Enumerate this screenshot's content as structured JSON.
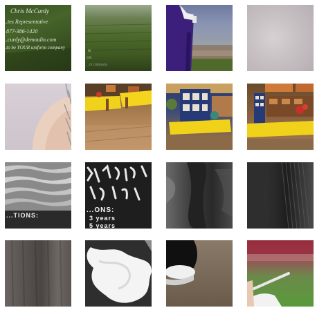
{
  "grid": {
    "tiles": [
      {
        "id": "business-card-on-grass",
        "lines": [
          "Chris McCurdy",
          "...tes Representative",
          "877-386-1420",
          "...curdy@demoulin.com",
          "...to be YOUR uniform company"
        ]
      },
      {
        "id": "grass-field"
      },
      {
        "id": "marching-band-purple-uniform"
      },
      {
        "id": "grey-fabric-close"
      },
      {
        "id": "arm-with-pompom"
      },
      {
        "id": "booth-yellow-tables"
      },
      {
        "id": "booth-framed-photos"
      },
      {
        "id": "booth-shelves-flowers"
      },
      {
        "id": "grey-banner-stripes",
        "lines": [
          "...TIONS:"
        ]
      },
      {
        "id": "black-banner-white-script",
        "lines": [
          "...ONS:",
          "3 years",
          "5 years"
        ]
      },
      {
        "id": "dark-grey-texture-1"
      },
      {
        "id": "dark-grey-texture-2"
      },
      {
        "id": "grey-blur-texture"
      },
      {
        "id": "white-feather-plume"
      },
      {
        "id": "white-hat-brim"
      },
      {
        "id": "baton-twirler-field"
      }
    ]
  }
}
